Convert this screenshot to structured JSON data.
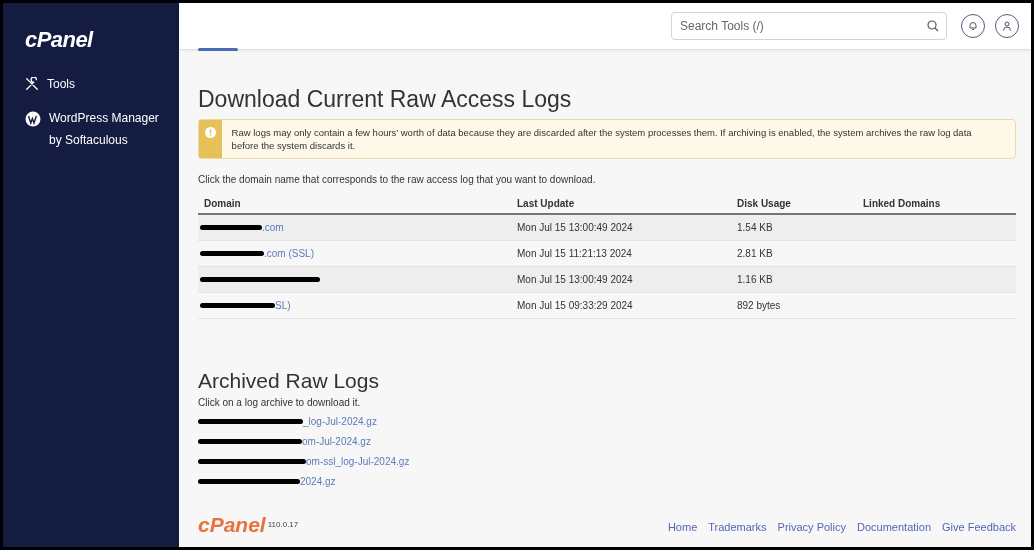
{
  "sidebar": {
    "logo": "cPanel",
    "items": [
      {
        "kind": "tools",
        "label": "Tools"
      },
      {
        "kind": "wordpress",
        "label": "WordPress Manager by Softaculous"
      }
    ]
  },
  "topbar": {
    "search": {
      "placeholder": "Search Tools (/)"
    }
  },
  "current_logs": {
    "title": "Download Current Raw Access Logs",
    "alert": "Raw logs may only contain a few hours’ worth of data because they are discarded after the system processes them. If archiving is enabled, the system archives the raw log data before the system discards it.",
    "instructions": "Click the domain name that corresponds to the raw access log that you want to download.",
    "columns": [
      "Domain",
      "Last Update",
      "Disk Usage",
      "Linked Domains"
    ],
    "rows": [
      {
        "domain": {
          "redacted": true,
          "visible": ".com"
        },
        "last_update": "Mon Jul 15 13:00:49 2024",
        "disk_usage": "1.54 KB"
      },
      {
        "domain": {
          "redacted": true,
          "visible": ".com (SSL)"
        },
        "last_update": "Mon Jul 15 11:21:13 2024",
        "disk_usage": "2.81 KB"
      },
      {
        "domain": {
          "redacted": true
        },
        "last_update": "Mon Jul 15 13:00:49 2024",
        "disk_usage": "1.16 KB"
      },
      {
        "domain": {
          "redacted": true,
          "visible": "SL)"
        },
        "last_update": "Mon Jul 15 09:33:29 2024",
        "disk_usage": "892 bytes"
      }
    ]
  },
  "archived_logs": {
    "title": "Archived Raw Logs",
    "instructions": "Click on a log archive to download it.",
    "links": [
      {
        "redacted": true,
        "visible": "_log-Jul-2024.gz"
      },
      {
        "redacted": true,
        "visible": "om-Jul-2024.gz"
      },
      {
        "redacted": true,
        "visible": "om-ssl_log-Jul-2024.gz"
      },
      {
        "redacted": true,
        "visible": "2024.gz"
      }
    ]
  },
  "footer": {
    "logo": "cPanel",
    "version": "110.0.17",
    "links": [
      "Home",
      "Trademarks",
      "Privacy Policy",
      "Documentation",
      "Give Feedback"
    ]
  }
}
